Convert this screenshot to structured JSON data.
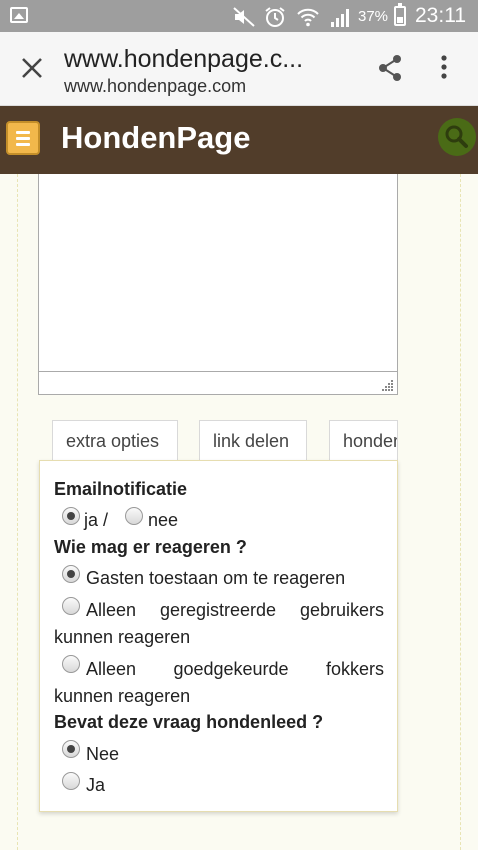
{
  "status_bar": {
    "battery_percent": "37%",
    "time": "23:11",
    "icons": [
      "gallery-icon",
      "mute-icon",
      "alarm-icon",
      "wifi-icon",
      "signal-icon",
      "battery-icon"
    ]
  },
  "tab_header": {
    "title": "www.hondenpage.c...",
    "url": "www.hondenpage.com",
    "icons": [
      "close-icon",
      "share-icon",
      "more-vert-icon"
    ]
  },
  "site_header": {
    "logo": "HondenPage",
    "icons": [
      "menu-icon",
      "search-icon"
    ],
    "colors": {
      "background": "#513d2a",
      "menu_button": "#f2b84b",
      "search_button": "#4a6b16"
    }
  },
  "tabs": [
    "extra opties",
    "link delen",
    "honden"
  ],
  "options": {
    "email_notification": {
      "label": "Emailnotificatie",
      "choices": [
        "ja /",
        "nee"
      ],
      "selected": "ja /"
    },
    "who_can_respond": {
      "label": "Wie mag er reageren ?",
      "choices": [
        {
          "words": [
            "Gasten toestaan om te reageren"
          ],
          "cont": ""
        },
        {
          "words": [
            "Alleen",
            "geregistreerde",
            "gebruikers"
          ],
          "cont": "kunnen reageren"
        },
        {
          "words": [
            "Alleen",
            "goedgekeurde",
            "fokkers"
          ],
          "cont": "kunnen reageren"
        }
      ],
      "selected_index": 0
    },
    "dog_suffering": {
      "label": "Bevat deze vraag hondenleed ?",
      "choices": [
        "Nee",
        "Ja"
      ],
      "selected": "Nee"
    }
  }
}
